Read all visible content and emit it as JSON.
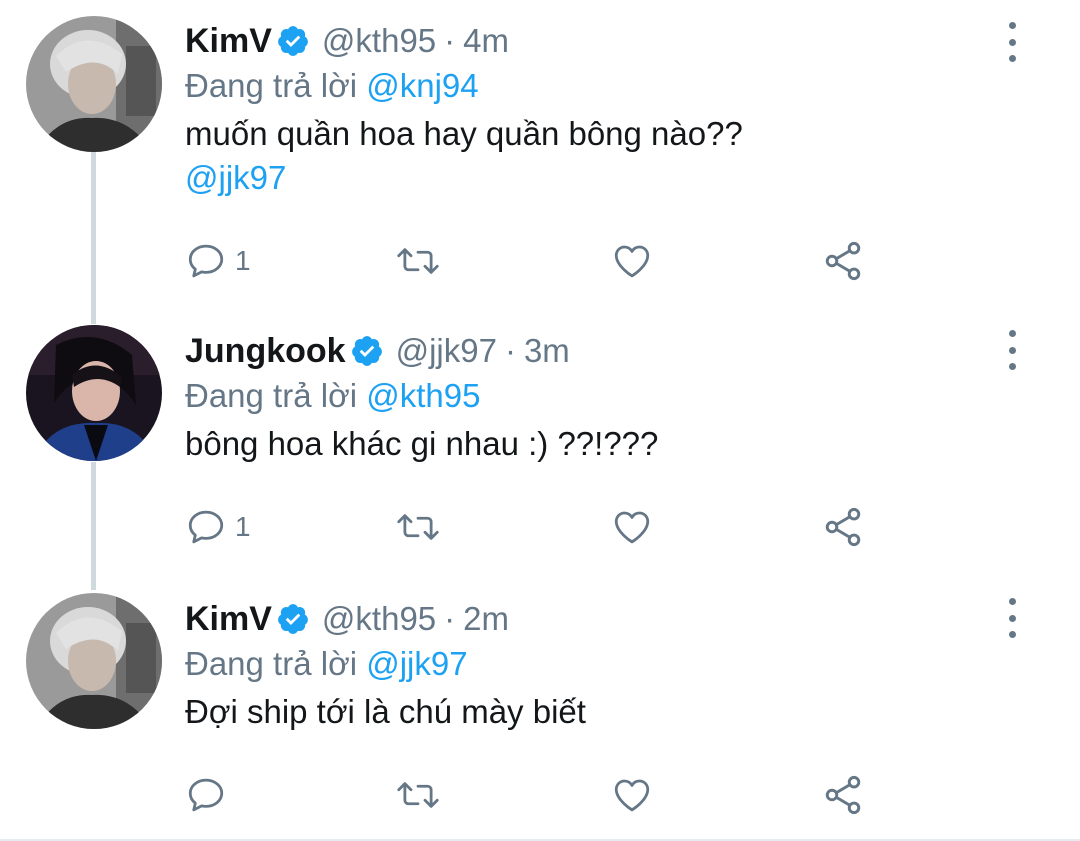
{
  "thread": {
    "tweets": [
      {
        "name": "KimV",
        "handle": "@kth95",
        "sep": "·",
        "time": "4m",
        "reply_prefix": "Đang trả lời",
        "reply_to": "@knj94",
        "text": "muốn quần hoa hay quần bông nào??",
        "mention": "@jjk97",
        "reply_count": "1",
        "avatar": "kimv-avatar"
      },
      {
        "name": "Jungkook",
        "handle": "@jjk97",
        "sep": "·",
        "time": "3m",
        "reply_prefix": "Đang trả lời",
        "reply_to": "@kth95",
        "text": "bông hoa khác gi nhau :) ??!???",
        "mention": "",
        "reply_count": "1",
        "avatar": "jungkook-avatar"
      },
      {
        "name": "KimV",
        "handle": "@kth95",
        "sep": "·",
        "time": "2m",
        "reply_prefix": "Đang trả lời",
        "reply_to": "@jjk97",
        "text": "Đợi ship tới là chú mày biết",
        "mention": "",
        "reply_count": "",
        "avatar": "kimv-avatar"
      }
    ]
  },
  "icons": {
    "verified": "verified-badge-icon",
    "reply": "reply-icon",
    "retweet": "retweet-icon",
    "like": "heart-icon",
    "share": "share-icon",
    "more": "more-options-icon"
  },
  "colors": {
    "accent": "#1da1f2",
    "secondary_text": "#657786",
    "primary_text": "#14171a",
    "thread_line": "#cfd9de"
  }
}
